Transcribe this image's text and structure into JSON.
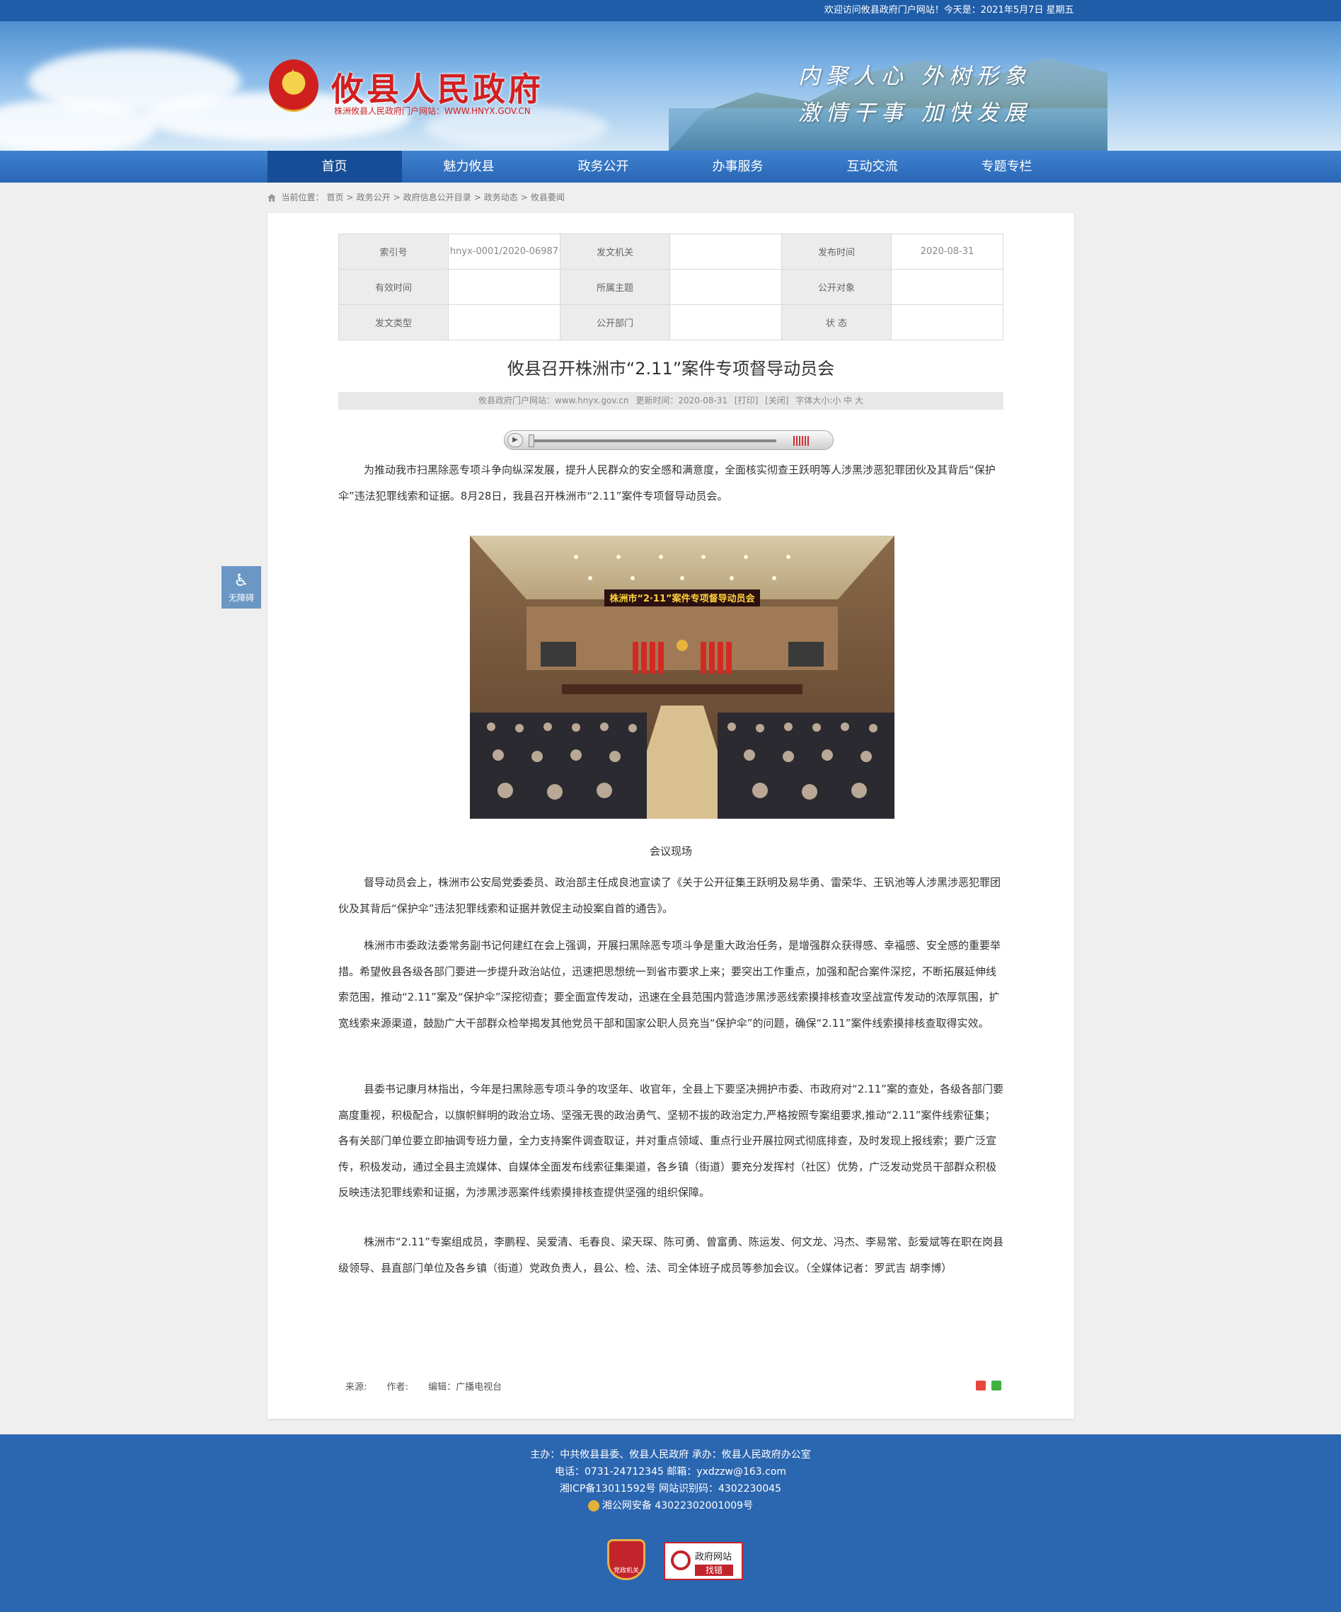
{
  "topbar": {
    "welcome": "欢迎访问攸县政府门户网站！今天是：2021年5月7日 星期五"
  },
  "header": {
    "site_title": "攸县人民政府",
    "site_url": "株洲攸县人民政府门户网站：WWW.HNYX.GOV.CN",
    "slogan_line1": "内聚人心 外树形象",
    "slogan_line2": "激情干事 加快发展"
  },
  "nav": {
    "items": [
      "首页",
      "魅力攸县",
      "政务公开",
      "办事服务",
      "互动交流",
      "专题专栏"
    ],
    "active": 0
  },
  "breadcrumb": {
    "label": "当前位置：",
    "items": [
      "首页",
      "政务公开",
      "政府信息公开目录",
      "政务动态",
      "攸县要闻"
    ],
    "sep": ">"
  },
  "meta_table": {
    "rows": [
      [
        {
          "k": "索引号",
          "v": "hnyx-0001/2020-06987"
        },
        {
          "k": "发文机关",
          "v": ""
        },
        {
          "k": "发布时间",
          "v": "2020-08-31"
        }
      ],
      [
        {
          "k": "有效时间",
          "v": ""
        },
        {
          "k": "所属主题",
          "v": ""
        },
        {
          "k": "公开对象",
          "v": ""
        }
      ],
      [
        {
          "k": "发文类型",
          "v": ""
        },
        {
          "k": "公开部门",
          "v": ""
        },
        {
          "k": "状 态",
          "v": ""
        }
      ]
    ]
  },
  "article": {
    "title": "攸县召开株洲市“2.11”案件专项督导动员会",
    "info": {
      "source": "攸县政府门户网站：www.hnyx.gov.cn",
      "updated": "更新时间：2020-08-31",
      "print": "[打印]",
      "close": "[关闭]",
      "font_size": "字体大小:小 中 大"
    },
    "para1": "为推动我市扫黑除恶专项斗争向纵深发展，提升人民群众的安全感和满意度，全面核实彻查王跃明等人涉黑涉恶犯罪团伙及其背后“保护伞”违法犯罪线索和证据。8月28日，我县召开株洲市“2.11”案件专项督导动员会。",
    "photo_banner": "株洲市“2·11”案件专项督导动员会",
    "caption": "会议现场",
    "para2": "督导动员会上，株洲市公安局党委委员、政治部主任成良池宣读了《关于公开征集王跃明及易华勇、雷荣华、王钒池等人涉黑涉恶犯罪团伙及其背后“保护伞”违法犯罪线索和证据并敦促主动投案自首的通告》。",
    "para3": "株洲市市委政法委常务副书记何建红在会上强调，开展扫黑除恶专项斗争是重大政治任务，是增强群众获得感、幸福感、安全感的重要举措。希望攸县各级各部门要进一步提升政治站位，迅速把思想统一到省市要求上来；要突出工作重点，加强和配合案件深挖，不断拓展延伸线索范围，推动“2.11”案及“保护伞”深挖彻查；要全面宣传发动，迅速在全县范围内营造涉黑涉恶线索摸排核查攻坚战宣传发动的浓厚氛围，扩宽线索来源渠道，鼓励广大干部群众检举揭发其他党员干部和国家公职人员充当“保护伞”的问题，确保“2.11”案件线索摸排核查取得实效。",
    "para4": "县委书记康月林指出，今年是扫黑除恶专项斗争的攻坚年、收官年，全县上下要坚决拥护市委、市政府对“2.11”案的查处，各级各部门要高度重视，积极配合，以旗帜鲜明的政治立场、坚强无畏的政治勇气、坚韧不拔的政治定力,严格按照专案组要求,推动“2.11”案件线索征集；各有关部门单位要立即抽调专班力量，全力支持案件调查取证，并对重点领域、重点行业开展拉网式彻底排查，及时发现上报线索；要广泛宣传，积极发动，通过全县主流媒体、自媒体全面发布线索征集渠道，各乡镇（街道）要充分发挥村（社区）优势，广泛发动党员干部群众积极反映违法犯罪线索和证据，为涉黑涉恶案件线索摸排核查提供坚强的组织保障。",
    "para5": "株洲市“2.11”专案组成员，李鹏程、吴爱清、毛春良、梁天琛、陈可勇、曾富勇、陈运发、何文龙、冯杰、李易常、彭爱斌等在职在岗县级领导、县直部门单位及各乡镇（街道）党政负责人，县公、检、法、司全体班子成员等参加会议。（全媒体记者：罗武吉 胡李博）",
    "footer_source": "来源:",
    "footer_author": "作者:",
    "footer_editor": "编辑：广播电视台"
  },
  "accessibility": {
    "label": "无障碍"
  },
  "footer": {
    "line1": "主办：中共攸县县委、攸县人民政府 承办：攸县人民政府办公室",
    "line2": "电话：0731-24712345 邮箱：yxdzzw@163.com",
    "line3": "湘ICP备13011592号 网站识别码：4302230045",
    "line4": "湘公网安备 43022302001009号",
    "badge1_text": "党政机关",
    "badge2_line1": "政府网站",
    "badge2_line2": "找错"
  },
  "colors": {
    "nav_bg": "#2966b5",
    "nav_active": "#174d96",
    "title_red": "#d21f1f",
    "footer_bg": "#2b66b0"
  }
}
